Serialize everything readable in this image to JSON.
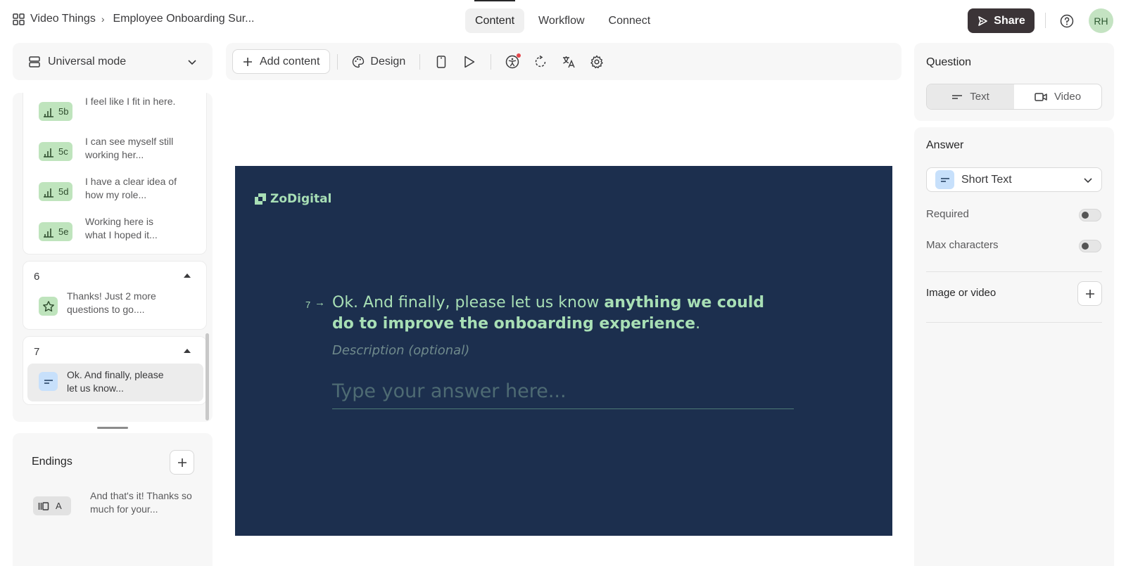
{
  "breadcrumb": {
    "workspace": "Video Things",
    "separator": "›",
    "form_title": "Employee Onboarding Sur..."
  },
  "tabs": [
    {
      "label": "Content",
      "active": true
    },
    {
      "label": "Workflow",
      "active": false
    },
    {
      "label": "Connect",
      "active": false
    }
  ],
  "header": {
    "share_label": "Share",
    "avatar_initials": "RH"
  },
  "mode_selector": {
    "label": "Universal mode"
  },
  "question_list": {
    "group5_items": [
      {
        "badge": "5b",
        "text": "I feel like I fit in here."
      },
      {
        "badge": "5c",
        "text": "I can see myself still working her..."
      },
      {
        "badge": "5d",
        "text": "I have a clear idea of how my role..."
      },
      {
        "badge": "5e",
        "text": "Working here is what I hoped it..."
      }
    ],
    "group6": {
      "number": "6",
      "item_text": "Thanks! Just 2 more questions to go...."
    },
    "group7": {
      "number": "7",
      "item_text": "Ok. And finally, please let us know..."
    }
  },
  "endings": {
    "title": "Endings",
    "item_badge": "A",
    "item_text": "And that's it! Thanks so much for your..."
  },
  "toolbar": {
    "add_content_label": "Add content",
    "design_label": "Design"
  },
  "canvas": {
    "background_color": "#1c2f4e",
    "accent_color": "#a8dfb5",
    "brand": "ZoDigital",
    "question_number": "7",
    "arrow": "→",
    "question_text_plain": "Ok. And finally, please let us know ",
    "question_text_bold": "anything we could do to improve the onboarding experience",
    "question_text_end": ".",
    "description_placeholder": "Description (optional)",
    "answer_placeholder": "Type your answer here..."
  },
  "right_panel": {
    "question_label": "Question",
    "question_types": [
      "Text",
      "Video"
    ],
    "answer_label": "Answer",
    "answer_type": "Short Text",
    "required_label": "Required",
    "required_on": false,
    "max_chars_label": "Max characters",
    "max_chars_on": false,
    "image_video_label": "Image or video"
  }
}
